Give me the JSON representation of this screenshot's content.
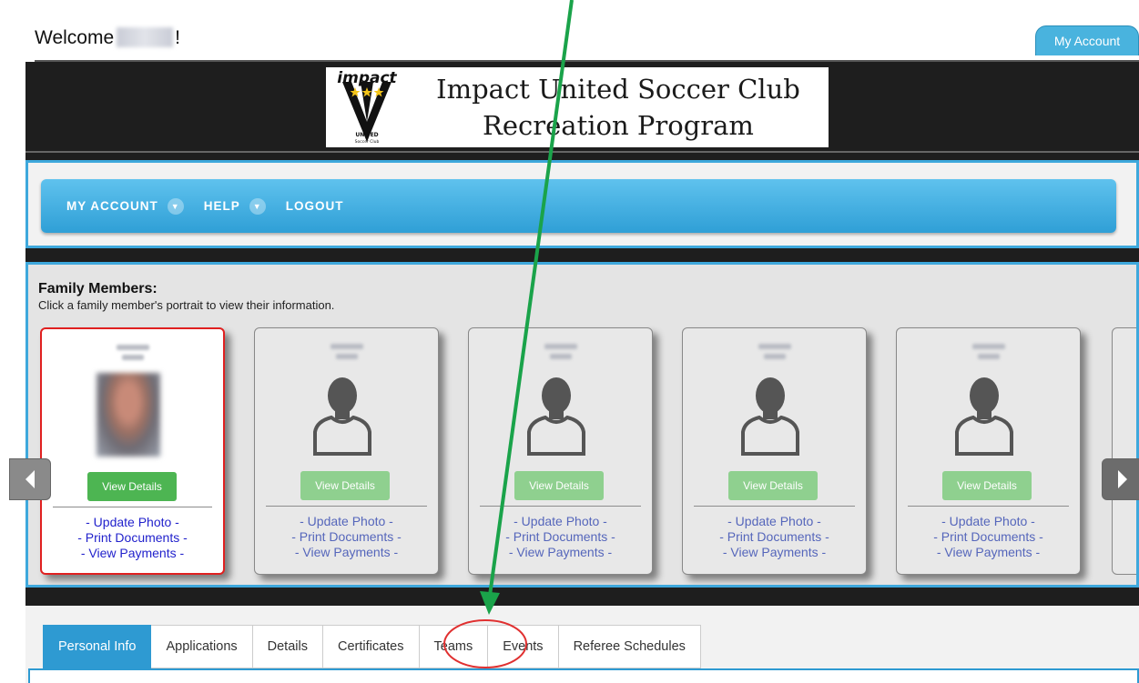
{
  "header": {
    "welcome_prefix": "Welcome",
    "welcome_suffix": "!",
    "my_account_tab": "My Account"
  },
  "banner": {
    "title_line1": "Impact United Soccer Club",
    "title_line2": "Recreation Program",
    "logo_word": "impact",
    "logo_sub": "UNITED",
    "logo_sub2": "Soccer Club"
  },
  "nav": {
    "items": [
      {
        "label": "MY ACCOUNT",
        "has_dropdown": true
      },
      {
        "label": "HELP",
        "has_dropdown": true
      },
      {
        "label": "LOGOUT",
        "has_dropdown": false
      }
    ]
  },
  "family": {
    "title": "Family Members:",
    "subtitle": "Click a family member's portrait to view their information.",
    "view_details": "View Details",
    "links": [
      "- Update Photo -",
      "- Print Documents -",
      "- View Payments -"
    ],
    "members": [
      {
        "selected": true,
        "has_photo": true
      },
      {
        "selected": false,
        "has_photo": false
      },
      {
        "selected": false,
        "has_photo": false
      },
      {
        "selected": false,
        "has_photo": false
      },
      {
        "selected": false,
        "has_photo": false
      }
    ]
  },
  "tabs": {
    "items": [
      "Personal Info",
      "Applications",
      "Details",
      "Certificates",
      "Teams",
      "Events",
      "Referee Schedules"
    ],
    "active": "Personal Info",
    "highlighted": "Teams"
  },
  "colors": {
    "accent": "#3ea8dc",
    "view_details_active": "#4db552",
    "annotation_arrow": "#1aa34a",
    "annotation_circle": "#e03030"
  }
}
